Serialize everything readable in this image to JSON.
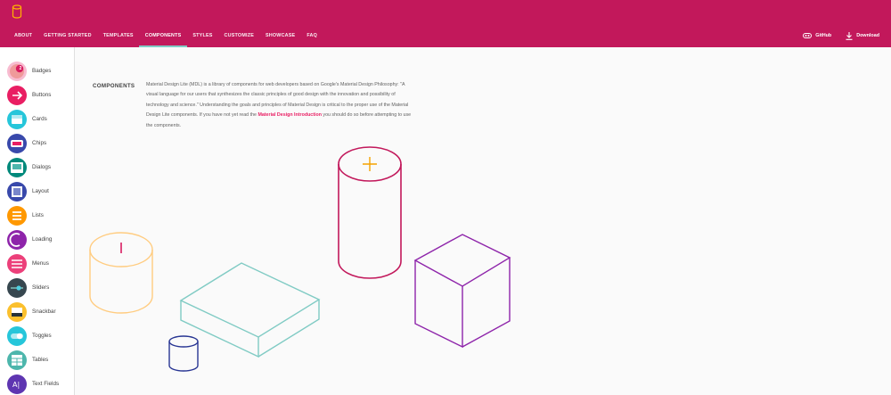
{
  "header": {
    "logo_icon": "cylinder-logo-icon",
    "nav": [
      {
        "label": "ABOUT",
        "active": false
      },
      {
        "label": "GETTING STARTED",
        "active": false
      },
      {
        "label": "TEMPLATES",
        "active": false
      },
      {
        "label": "COMPONENTS",
        "active": true
      },
      {
        "label": "STYLES",
        "active": false
      },
      {
        "label": "CUSTOMIZE",
        "active": false
      },
      {
        "label": "SHOWCASE",
        "active": false
      },
      {
        "label": "FAQ",
        "active": false
      }
    ],
    "github_label": "GitHub",
    "download_label": "Download"
  },
  "sidebar": {
    "items": [
      {
        "label": "Badges",
        "icon": "badge-icon",
        "color": "#f8bbd0",
        "badge": "2"
      },
      {
        "label": "Buttons",
        "icon": "arrow-right-icon",
        "color": "#e91e63"
      },
      {
        "label": "Cards",
        "icon": "card-icon",
        "color": "#26c6da"
      },
      {
        "label": "Chips",
        "icon": "chip-icon",
        "color": "#3949ab"
      },
      {
        "label": "Dialogs",
        "icon": "dialog-icon",
        "color": "#00897b"
      },
      {
        "label": "Layout",
        "icon": "layout-icon",
        "color": "#3949ab"
      },
      {
        "label": "Lists",
        "icon": "list-icon",
        "color": "#ff9800"
      },
      {
        "label": "Loading",
        "icon": "loading-icon",
        "color": "#8e24aa"
      },
      {
        "label": "Menus",
        "icon": "menu-icon",
        "color": "#ec407a"
      },
      {
        "label": "Sliders",
        "icon": "slider-icon",
        "color": "#37474f"
      },
      {
        "label": "Snackbar",
        "icon": "snackbar-icon",
        "color": "#fbc02d"
      },
      {
        "label": "Toggles",
        "icon": "toggle-icon",
        "color": "#26c6da"
      },
      {
        "label": "Tables",
        "icon": "table-icon",
        "color": "#4db6ac"
      },
      {
        "label": "Text Fields",
        "icon": "text-field-icon",
        "color": "#5e35b1"
      }
    ]
  },
  "main": {
    "section_title": "COMPONENTS",
    "intro_part1": "Material Design Lite (MDL) is a library of components for web developers based on Google's Material Design Philosophy: \"A visual language for our users that synthesizes the classic principles of good design with the innovation and possibility of technology and science.\" Understanding the goals and principles of Material Design is critical to the proper use of the Material Design Lite components. If you have not yet read the ",
    "intro_link": "Material Design Introduction",
    "intro_part2": " you should do so before attempting to use the components."
  },
  "colors": {
    "primary": "#c2185b",
    "accent": "#80cbc4",
    "link": "#e91e63"
  }
}
